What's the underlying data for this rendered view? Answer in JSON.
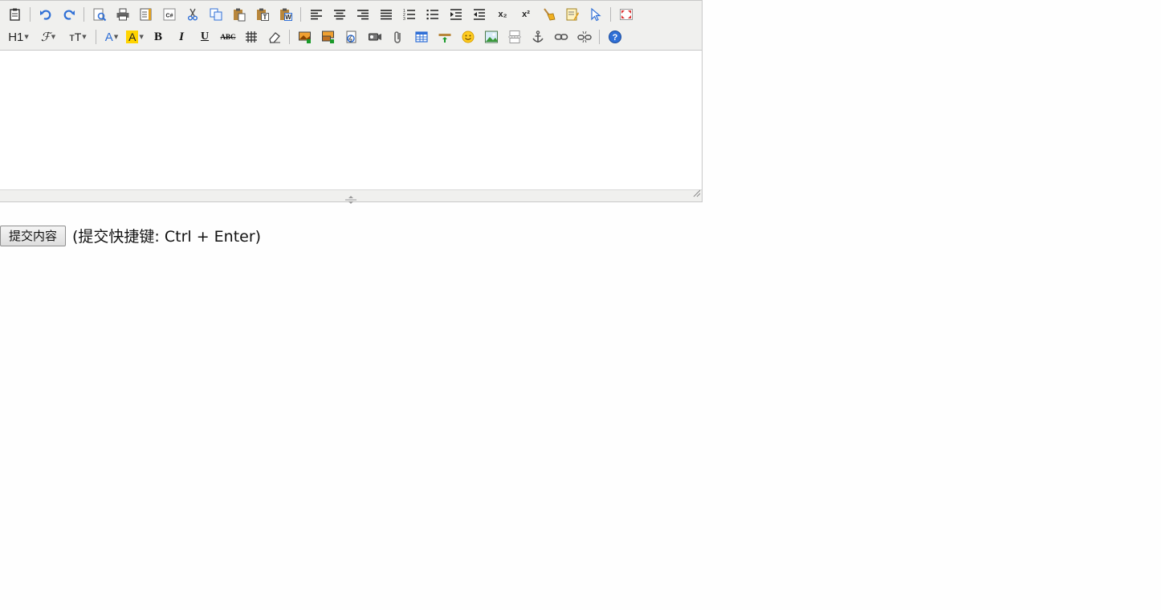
{
  "toolbar": {
    "heading_label": "H1",
    "font_family_glyph": "ℱ",
    "font_size_glyph": "тT",
    "font_color_glyph": "A",
    "bg_color_glyph": "A",
    "bold_glyph": "B",
    "italic_glyph": "I",
    "underline_glyph": "U",
    "strike_glyph": "ABC",
    "subscript_glyph": "x₂",
    "superscript_glyph": "x²",
    "source_glyph": "C#",
    "accent_color": "#2f6fd6",
    "highlight_color": "#ffd400"
  },
  "submit": {
    "button_label": "提交内容",
    "hint": "(提交快捷键: Ctrl + Enter)"
  }
}
